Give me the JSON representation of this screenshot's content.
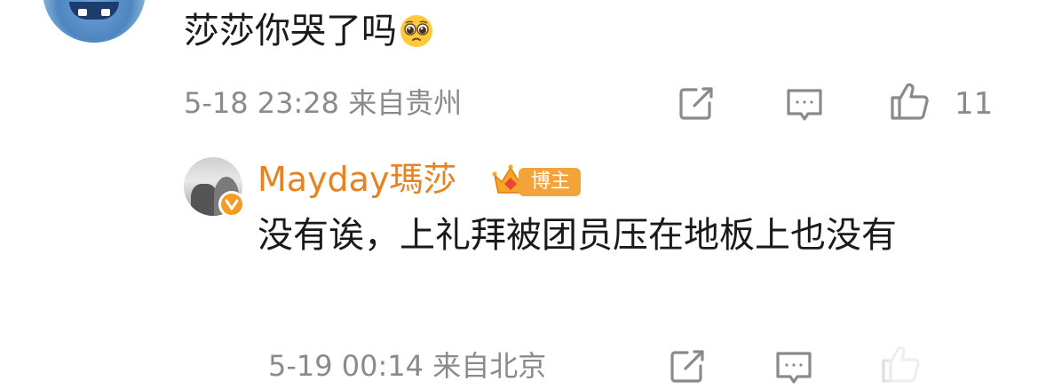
{
  "top_comment": {
    "text": "莎莎你哭了吗",
    "emoji": "pleading-face-emoji",
    "timestamp": "5-18 23:28",
    "location": "来自贵州",
    "like_count": "11"
  },
  "reply": {
    "author": "Mayday瑪莎",
    "badge": "博主",
    "text": "没有诶，上礼拜被团员压在地板上也没有",
    "timestamp": "5-19 00:14",
    "location": "来自北京"
  },
  "colors": {
    "author_name": "#e8811f",
    "badge_bg": "#f3a33a",
    "meta_text": "#8a8a8a",
    "verified_bg": "#f59a23"
  },
  "icons": {
    "share": "share-icon",
    "comment": "comment-icon",
    "like": "thumbs-up-icon",
    "verified": "verified-badge-icon",
    "crown": "crown-icon"
  }
}
